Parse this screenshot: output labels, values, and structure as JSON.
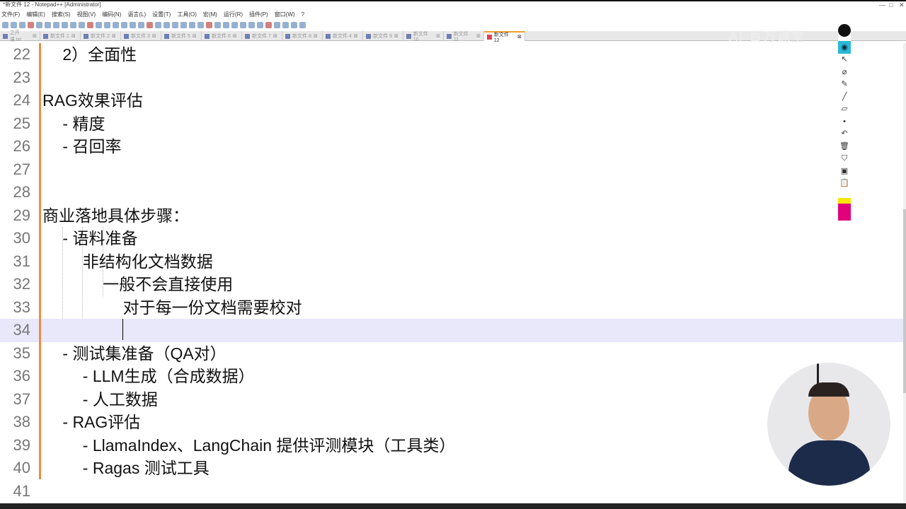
{
  "window": {
    "title": "*新文件 12 - Notepad++ [Administrator]",
    "minimize": "—",
    "maximize": "□",
    "close": "✕"
  },
  "menu": [
    "文件(F)",
    "编辑(E)",
    "搜索(S)",
    "视图(V)",
    "编码(N)",
    "语言(L)",
    "设置(T)",
    "工具(O)",
    "宏(M)",
    "运行(R)",
    "插件(P)",
    "窗口(W)",
    "?"
  ],
  "tabs": [
    {
      "label": "之开课.txt"
    },
    {
      "label": "新文件 1"
    },
    {
      "label": "新文件 2"
    },
    {
      "label": "新文件 3"
    },
    {
      "label": "新文件 5"
    },
    {
      "label": "新文件 6"
    },
    {
      "label": "新文件 7"
    },
    {
      "label": "新文件 8"
    },
    {
      "label": "新文件 4"
    },
    {
      "label": "新文件 9"
    },
    {
      "label": "新文件 10"
    },
    {
      "label": "新文件 11"
    },
    {
      "label": "新文件 12",
      "active": true
    }
  ],
  "watermark": "AI 百万课堂",
  "editor": {
    "current_line": 34,
    "lines": [
      {
        "n": "22",
        "text": "  2）全面性"
      },
      {
        "n": "23",
        "text": ""
      },
      {
        "n": "24",
        "text": "RAG效果评估"
      },
      {
        "n": "25",
        "text": "  - 精度"
      },
      {
        "n": "26",
        "text": "  - 召回率"
      },
      {
        "n": "27",
        "text": ""
      },
      {
        "n": "28",
        "text": ""
      },
      {
        "n": "29",
        "text": "商业落地具体步骤："
      },
      {
        "n": "30",
        "text": "  - 语料准备"
      },
      {
        "n": "31",
        "text": "    非结构化文档数据"
      },
      {
        "n": "32",
        "text": "      一般不会直接使用"
      },
      {
        "n": "33",
        "text": "        对于每一份文档需要校对"
      },
      {
        "n": "34",
        "text": ""
      },
      {
        "n": "35",
        "text": "  - 测试集准备（QA对）"
      },
      {
        "n": "36",
        "text": "    - LLM生成（合成数据）"
      },
      {
        "n": "37",
        "text": "    - 人工数据"
      },
      {
        "n": "38",
        "text": "  - RAG评估"
      },
      {
        "n": "39",
        "text": "    - LlamaIndex、LangChain 提供评测模块（工具类）"
      },
      {
        "n": "40",
        "text": "    - Ragas 测试工具"
      },
      {
        "n": "41",
        "text": ""
      }
    ]
  },
  "pen_tools": [
    "eye",
    "pointer",
    "eraser",
    "marker",
    "line",
    "highlighter",
    "dot",
    "undo",
    "trash",
    "stamp",
    "camera",
    "clipboard"
  ],
  "colors": {
    "accent_tab": "#f0a030",
    "current_line": "#e8e8fa",
    "change_bar": "#f08a40"
  }
}
